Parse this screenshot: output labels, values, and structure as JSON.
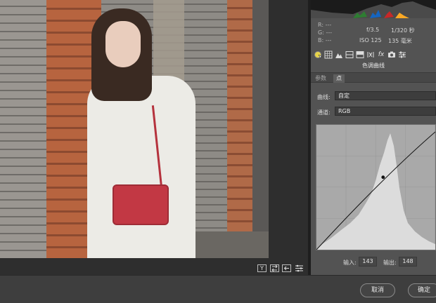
{
  "camera": {
    "r_label": "R:",
    "r_value": "---",
    "g_label": "G:",
    "g_value": "---",
    "b_label": "B:",
    "b_value": "---",
    "aperture": "f/3.5",
    "shutter": "1/320 秒",
    "iso": "ISO 125",
    "focal": "135 毫米"
  },
  "toolbar": {
    "icons": [
      "basic-circle-icon",
      "tone-curve-grid-icon",
      "detail-mountain-icon",
      "hsl-icon",
      "split-toning-icon",
      "lens-icon",
      "effects-fx-icon",
      "camera-icon",
      "presets-sliders-icon"
    ],
    "fx_label": "fx"
  },
  "section_title": "色调曲线",
  "subtabs": {
    "parametric": "参数",
    "point": "点"
  },
  "curve_row": {
    "label": "曲线:",
    "value": "自定"
  },
  "channel_row": {
    "label": "通道:",
    "value": "RGB"
  },
  "curve_point": {
    "input": 143,
    "output": 148
  },
  "io": {
    "input_label": "输入:",
    "input_value": "143",
    "output_label": "输出:",
    "output_value": "148"
  },
  "photo_toolbar": {
    "y_label": "Y"
  },
  "buttons": {
    "cancel": "取消",
    "ok": "确定"
  }
}
